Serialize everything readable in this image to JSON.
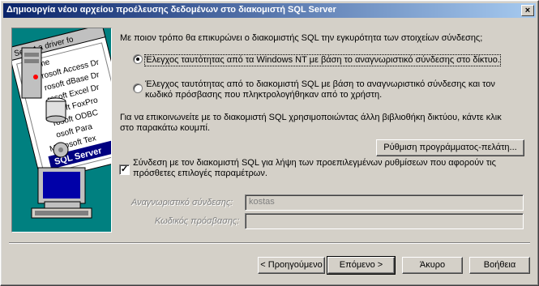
{
  "window": {
    "title": "Δημιουργία νέου αρχείου προέλευσης δεδομένων στο διακομιστή SQL Server",
    "close_glyph": "×"
  },
  "art": {
    "header": "Select a driver fo",
    "items": [
      "me",
      "rosoft Access Dr",
      "rosoft dBase Dr",
      "rosoft Excel Dr",
      "rosoft FoxPro",
      "rosoft ODBC",
      "osoft Para",
      "Microsoft Tex",
      "SQL Server"
    ]
  },
  "question": "Με ποιον τρόπο θα επικυρώνει ο διακομιστής SQL την εγκυρότητα των στοιχείων σύνδεσης;",
  "auth": {
    "option1": "Έλεγχος ταυτότητας από τα  Windows NT με βάση το αναγνωριστικό σύνδεσης στο δίκτυο.",
    "option2_line1": "Έλεγχος ταυτότητας από το διακομιστή SQL με βάση το αναγνωριστικό σύνδεσης και τον",
    "option2_line2": "κωδικό πρόσβασης που πληκτρολογήθηκαν από το χρήστη.",
    "selected": 1
  },
  "network_text_line1": "Για να επικοινωνείτε με το διακομιστή SQL χρησιμοποιώντας άλλη βιβλιοθήκη δικτύου, κάντε κλικ",
  "network_text_line2": "στο παρακάτω κουμπί.",
  "client_config_button": "Ρύθμιση προγράμματος-πελάτη...",
  "connect_check": {
    "checked": true,
    "mark": "✓",
    "line1": "Σύνδεση με τον διακομιστή SQL για λήψη των προεπιλεγμένων ρυθμίσεων που αφορούν τις",
    "line2": "πρόσθετες επιλογές παραμέτρων."
  },
  "login": {
    "id_label": "Αναγνωριστικό σύνδεσης:",
    "id_value": "kostas",
    "password_label": "Κωδικός πρόσβασης:",
    "password_value": ""
  },
  "buttons": {
    "back": "< Προηγούμενο",
    "next": "Επόμενο >",
    "cancel": "Άκυρο",
    "help": "Βοήθεια"
  }
}
